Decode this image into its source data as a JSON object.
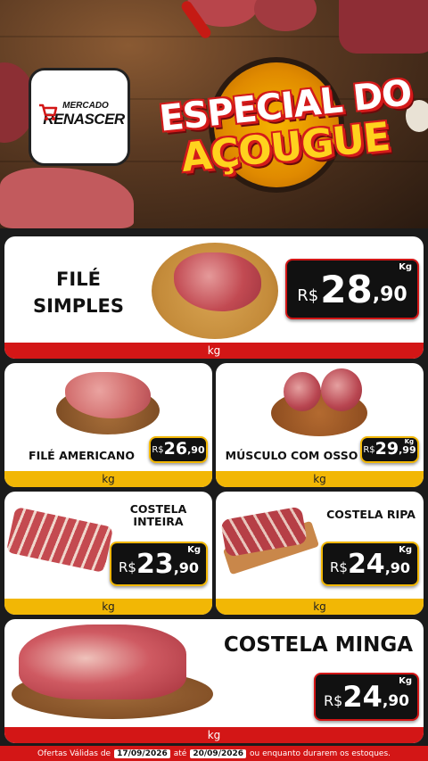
{
  "header": {
    "logo": {
      "line1": "MERCADO",
      "line2": "RENASCER"
    },
    "title_line1": "ESPECIAL DO",
    "title_line2": "AÇOUGUE"
  },
  "currency": "R$",
  "products": [
    {
      "name": "FILÉ SIMPLES",
      "price_int": "28",
      "price_dec": ",90",
      "price_unit": "Kg",
      "unit": "kg"
    },
    {
      "name": "FILÉ AMERICANO",
      "price_int": "26",
      "price_dec": ",90",
      "unit": "kg"
    },
    {
      "name": "MÚSCULO COM OSSO",
      "price_int": "29",
      "price_dec": ",99",
      "price_unit": "Kg",
      "unit": "kg"
    },
    {
      "name_line1": "COSTELA",
      "name_line2": "INTEIRA",
      "price_int": "23",
      "price_dec": ",90",
      "price_unit": "Kg",
      "unit": "kg"
    },
    {
      "name": "COSTELA RIPA",
      "price_int": "24",
      "price_dec": ",90",
      "price_unit": "Kg",
      "unit": "kg"
    },
    {
      "name": "COSTELA MINGA",
      "price_int": "24",
      "price_dec": ",90",
      "price_unit": "Kg",
      "unit": "kg"
    }
  ],
  "footer": {
    "prefix": "Ofertas Válidas de",
    "date_from": "17/09/2026",
    "middle": "até",
    "date_to": "20/09/2026",
    "suffix": "ou enquanto durarem os estoques."
  },
  "colors": {
    "red": "#d31616",
    "yellow": "#f2b705",
    "dark": "#1b1b1b"
  }
}
